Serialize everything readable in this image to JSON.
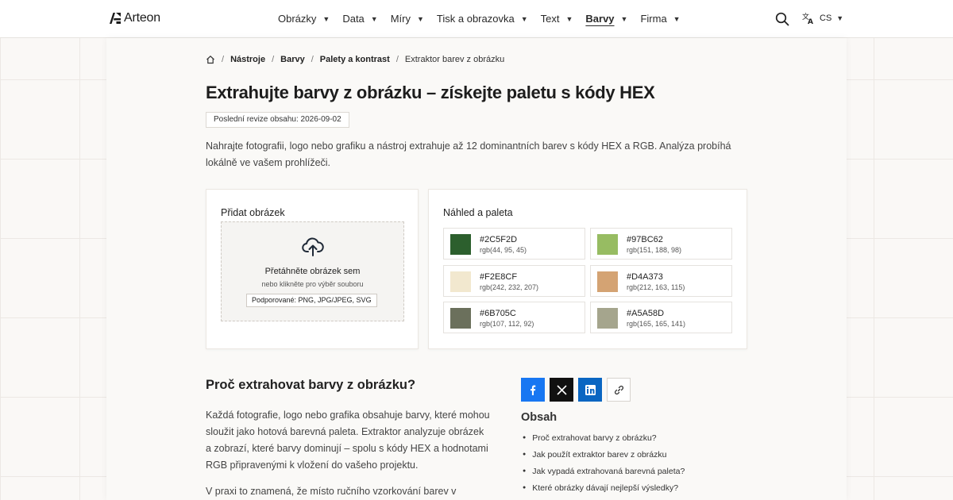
{
  "header": {
    "brand": "Arteon",
    "nav": [
      {
        "label": "Obrázky",
        "active": false
      },
      {
        "label": "Data",
        "active": false
      },
      {
        "label": "Míry",
        "active": false
      },
      {
        "label": "Tisk a obrazovka",
        "active": false
      },
      {
        "label": "Text",
        "active": false
      },
      {
        "label": "Barvy",
        "active": true
      },
      {
        "label": "Firma",
        "active": false
      }
    ],
    "language": "CS",
    "icons": {
      "search": "search-icon",
      "language": "translate-icon",
      "home": "home-icon"
    }
  },
  "breadcrumb": {
    "items": [
      "Nástroje",
      "Barvy",
      "Palety a kontrast"
    ],
    "current": "Extraktor barev z obrázku"
  },
  "page": {
    "title": "Extrahujte barvy z obrázku – získejte paletu s kódy HEX",
    "revision": "Poslední revize obsahu: 2026-09-02",
    "intro": "Nahrajte fotografii, logo nebo grafiku a nástroj extrahuje až 12 dominantních barev s kódy HEX a RGB. Analýza probíhá lokálně ve vašem prohlížeči."
  },
  "upload": {
    "title": "Přidat obrázek",
    "drop_main": "Přetáhněte obrázek sem",
    "drop_sub": "nebo klikněte pro výběr souboru",
    "formats": "Podporované: PNG, JPG/JPEG, SVG"
  },
  "palette": {
    "title": "Náhled a paleta",
    "swatches": [
      {
        "hex": "#2C5F2D",
        "rgb": "rgb(44, 95, 45)"
      },
      {
        "hex": "#97BC62",
        "rgb": "rgb(151, 188, 98)"
      },
      {
        "hex": "#F2E8CF",
        "rgb": "rgb(242, 232, 207)"
      },
      {
        "hex": "#D4A373",
        "rgb": "rgb(212, 163, 115)"
      },
      {
        "hex": "#6B705C",
        "rgb": "rgb(107, 112, 92)"
      },
      {
        "hex": "#A5A58D",
        "rgb": "rgb(165, 165, 141)"
      }
    ]
  },
  "article": {
    "heading": "Proč extrahovat barvy z obrázku?",
    "paragraphs": [
      "Každá fotografie, logo nebo grafika obsahuje barvy, které mohou sloužit jako hotová barevná paleta. Extraktor analyzuje obrázek a zobrazí, které barvy dominují – spolu s kódy HEX a hodnotami RGB připravenými k vložení do vašeho projektu.",
      "V praxi to znamená, že místo ručního vzorkování barev v"
    ]
  },
  "share": {
    "buttons": [
      "facebook-icon",
      "x-icon",
      "linkedin-icon",
      "link-icon"
    ],
    "colors": {
      "facebook": "#1877f2",
      "x": "#111111",
      "linkedin": "#0a66c2"
    }
  },
  "toc": {
    "title": "Obsah",
    "items": [
      "Proč extrahovat barvy z obrázku?",
      "Jak použít extraktor barev z obrázku",
      "Jak vypadá extrahovaná barevná paleta?",
      "Které obrázky dávají nejlepší výsledky?"
    ]
  }
}
